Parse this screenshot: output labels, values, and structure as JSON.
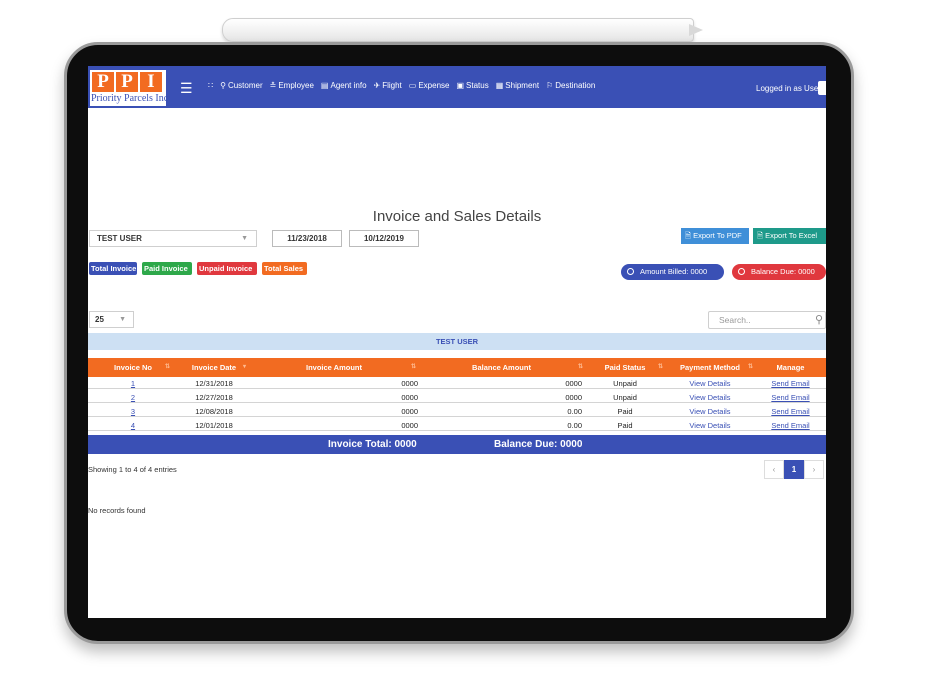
{
  "brand": {
    "logo_letters": [
      "P",
      "P",
      "I"
    ],
    "logo_subtitle": "Priority Parcels Inc.",
    "primary_color": "#3a50b5",
    "accent_color": "#f26b21"
  },
  "nav": {
    "items": [
      {
        "label": "Customer",
        "icon": "person-icon"
      },
      {
        "label": "Employee",
        "icon": "people-icon"
      },
      {
        "label": "Agent info",
        "icon": "id-card-icon"
      },
      {
        "label": "Flight",
        "icon": "plane-icon"
      },
      {
        "label": "Expense",
        "icon": "money-icon"
      },
      {
        "label": "Status",
        "icon": "status-icon"
      },
      {
        "label": "Shipment",
        "icon": "shipment-icon"
      },
      {
        "label": "Destination",
        "icon": "destination-icon"
      }
    ],
    "logged_in": "Logged in as User"
  },
  "page": {
    "title": "Invoice and Sales Details",
    "selected_user": "TEST USER",
    "date_from": "11/23/2018",
    "date_to": "10/12/2019",
    "export_pdf": "Export To PDF",
    "export_excel": "Export To Excel"
  },
  "filters": {
    "total_invoice": "Total Invoice",
    "paid_invoice": "Paid Invoice",
    "unpaid_invoice": "Unpaid Invoice",
    "total_sales": "Total Sales"
  },
  "summary": {
    "amount_billed": "Amount Billed: 0000",
    "balance_due": "Balance Due: 0000"
  },
  "table": {
    "page_size": "25",
    "search_placeholder": "Search..",
    "group_label": "TEST USER",
    "headers": [
      "Invoice No",
      "Invoice Date",
      "Invoice Amount",
      "Balance Amount",
      "Paid Status",
      "Payment Method",
      "Manage"
    ],
    "rows": [
      {
        "no": "1",
        "date": "12/31/2018",
        "amount": "0000",
        "balance": "0000",
        "status": "Unpaid",
        "method": "View Details",
        "manage": "Send Email"
      },
      {
        "no": "2",
        "date": "12/27/2018",
        "amount": "0000",
        "balance": "0000",
        "status": "Unpaid",
        "method": "View Details",
        "manage": "Send Email"
      },
      {
        "no": "3",
        "date": "12/08/2018",
        "amount": "0000",
        "balance": "0.00",
        "status": "Paid",
        "method": "View Details",
        "manage": "Send Email"
      },
      {
        "no": "4",
        "date": "12/01/2018",
        "amount": "0000",
        "balance": "0.00",
        "status": "Paid",
        "method": "View Details",
        "manage": "Send Email"
      }
    ],
    "footer_invoice_total": "Invoice Total: 0000",
    "footer_balance_due": "Balance Due: 0000",
    "showing": "Showing 1 to 4 of 4 entries",
    "current_page": "1",
    "no_records": "No records found"
  }
}
